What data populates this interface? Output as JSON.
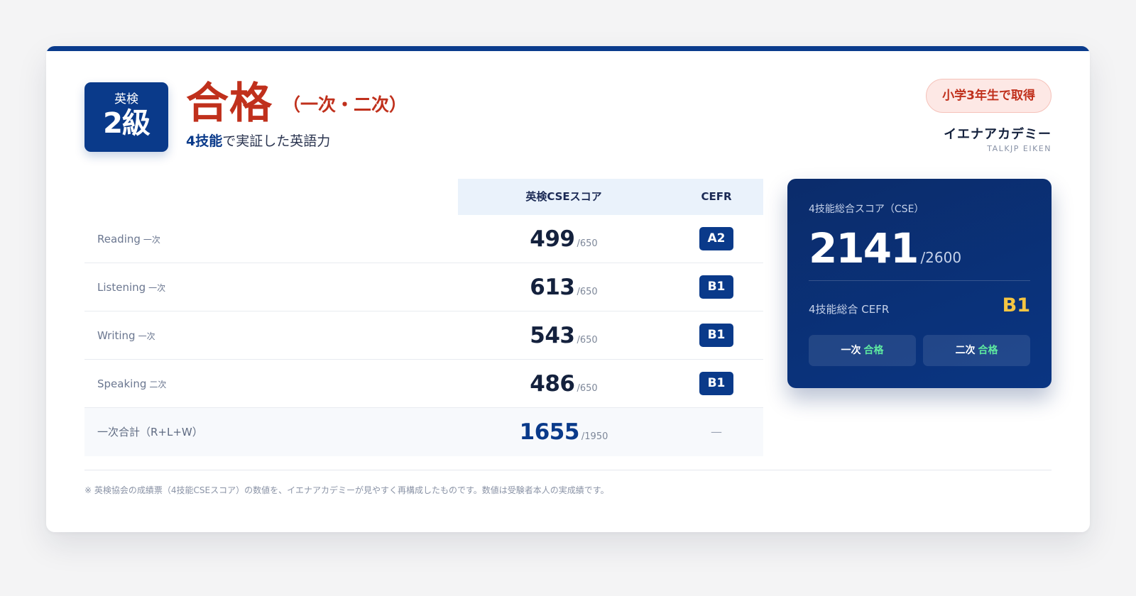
{
  "header": {
    "grade_label_small": "英検",
    "grade_label_big": "2級",
    "result": "合格",
    "result_detail": "（一次・二次）",
    "tagline_highlight": "4技能",
    "tagline_rest": "で実証した英語力"
  },
  "badge": {
    "achievement": "小学3年生で取得"
  },
  "academy": {
    "name": "イエナアカデミー",
    "subtitle": "TALKJP EIKEN"
  },
  "table": {
    "headers": {
      "cse": "英検CSEスコア",
      "cefr": "CEFR"
    },
    "rows": [
      {
        "skill": "Reading",
        "stage": "一次",
        "score": "499",
        "max": "/650",
        "cefr": "A2"
      },
      {
        "skill": "Listening",
        "stage": "一次",
        "score": "613",
        "max": "/650",
        "cefr": "B1"
      },
      {
        "skill": "Writing",
        "stage": "一次",
        "score": "543",
        "max": "/650",
        "cefr": "B1"
      },
      {
        "skill": "Speaking",
        "stage": "二次",
        "score": "486",
        "max": "/650",
        "cefr": "B1"
      }
    ],
    "total_row": {
      "label": "一次合計（R+L+W）",
      "score": "1655",
      "max": "/1950",
      "cefr": "—"
    }
  },
  "summary": {
    "score_label": "4技能総合スコア（CSE）",
    "score": "2141",
    "score_max": "/2600",
    "cefr_label": "4技能総合 CEFR",
    "cefr_value": "B1",
    "stage1_label": "一次",
    "stage1_result": "合格",
    "stage2_label": "二次",
    "stage2_result": "合格"
  },
  "footnote": "※ 英検協会の成績票（4技能CSEスコア）の数値を、イエナアカデミーが見やすく再構成したものです。数値は受験者本人の実成績です。",
  "colors": {
    "brand_navy": "#0a3a8a",
    "pass_red": "#c0301c",
    "cefr_gold": "#f5c542",
    "pass_green": "#5ee9a0"
  }
}
